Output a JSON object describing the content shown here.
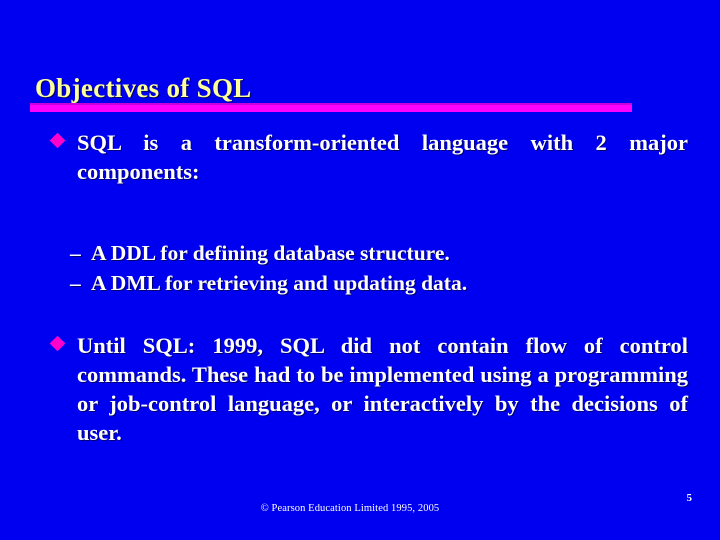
{
  "slide": {
    "background_color": "#0000f0",
    "title": "Objectives of SQL",
    "title_color": "#ffff99",
    "rule_color": "#ff00ff",
    "bullet_color": "#ff00cc",
    "body_color": "#ffffff"
  },
  "content": {
    "bullets": [
      {
        "marker": "◆",
        "text": "SQL is a transform-oriented language with 2 major components:",
        "sub_marker": "–",
        "sub_items": [
          "A DDL for defining database structure.",
          "A DML for retrieving and updating data."
        ]
      },
      {
        "marker": "◆",
        "text": "Until SQL: 1999, SQL did not contain flow of control commands. These had to be implemented using a programming or job-control language, or interactively by the decisions of user.",
        "sub_items": []
      }
    ]
  },
  "footer": {
    "credit": "© Pearson Education Limited 1995, 2005",
    "page_number": "5"
  }
}
